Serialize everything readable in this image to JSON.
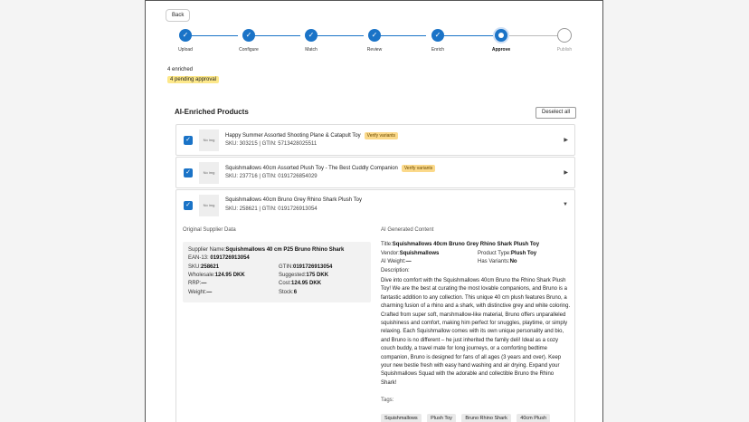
{
  "nav": {
    "back_label": "Back"
  },
  "stepper": {
    "steps": [
      {
        "label": "Upload",
        "state": "done"
      },
      {
        "label": "Configure",
        "state": "done"
      },
      {
        "label": "Match",
        "state": "done"
      },
      {
        "label": "Review",
        "state": "done"
      },
      {
        "label": "Enrich",
        "state": "done"
      },
      {
        "label": "Approve",
        "state": "current"
      },
      {
        "label": "Publish",
        "state": "future"
      }
    ]
  },
  "status": {
    "enriched": "4 enriched",
    "pending": "4 pending approval"
  },
  "section": {
    "title": "AI-Enriched Products",
    "deselect_label": "Deselect all"
  },
  "products": [
    {
      "name": "Happy Summer Assorted Shooting Plane & Catapult Toy",
      "meta": "SKU: 303215 | GTIN: 5713428025511",
      "badge": "Verify variants",
      "thumb": "No img",
      "arrow": "▶"
    },
    {
      "name": "Squishmallows 40cm Assorted Plush Toy - The Best Cuddly Companion",
      "meta": "SKU: 237716 | GTIN: 0191726854029",
      "badge": "Verify variants",
      "thumb": "No img",
      "arrow": "▶"
    },
    {
      "name": "Squishmallows 40cm Bruno Grey Rhino Shark Plush Toy",
      "meta": "SKU: 258621 | GTIN: 0191726913054",
      "badge": "",
      "thumb": "No img",
      "arrow": "▼"
    }
  ],
  "supplier": {
    "title": "Original Supplier Data",
    "name_label": "Supplier Name:",
    "name_value": "Squishmallows 40 cm P25 Bruno Rhino Shark",
    "ean_label": "EAN-13:",
    "ean_value": "0191726913054",
    "sku_label": "SKU:",
    "sku_value": "258621",
    "gtin_label": "GTIN:",
    "gtin_value": "0191726913054",
    "wholesale_label": "Wholesale:",
    "wholesale_value": "124.95 DKK",
    "suggested_label": "Suggested:",
    "suggested_value": "175 DKK",
    "rrp_label": "RRP:",
    "rrp_value": "—",
    "cost_label": "Cost:",
    "cost_value": "124.95 DKK",
    "weight_label": "Weight:",
    "weight_value": "—",
    "stock_label": "Stock:",
    "stock_value": "6"
  },
  "ai": {
    "title": "AI Generated Content",
    "title_label": "Title:",
    "title_value": "Squishmallows 40cm Bruno Grey Rhino Shark Plush Toy",
    "vendor_label": "Vendor:",
    "vendor_value": "Squishmallows",
    "ptype_label": "Product Type:",
    "ptype_value": "Plush Toy",
    "weight_label": "AI Weight:",
    "weight_value": "—",
    "variants_label": "Has Variants:",
    "variants_value": "No",
    "desc_label": "Description:",
    "description": "Dive into comfort with the Squishmallows 40cm Bruno the Rhino Shark Plush Toy! We are the best at curating the most lovable companions, and Bruno is a fantastic addition to any collection. This unique 40 cm plush features Bruno, a charming fusion of a rhino and a shark, with distinctive grey and white coloring. Crafted from super soft, marshmallow-like material, Bruno offers unparalleled squishiness and comfort, making him perfect for snuggles, playtime, or simply relaxing. Each Squishmallow comes with its own unique personality and bio, and Bruno is no different – he just inherited the family deli! Ideal as a cozy couch buddy, a travel mate for long journeys, or a comforting bedtime companion, Bruno is designed for fans of all ages (3 years and over). Keep your new bestie fresh with easy hand washing and air drying. Expand your Squishmallows Squad with the adorable and collectible Bruno the Rhino Shark!",
    "tags_label": "Tags:",
    "tags": [
      "Squishmallows",
      "Plush Toy",
      "Bruno Rhino Shark",
      "40cm Plush"
    ]
  }
}
